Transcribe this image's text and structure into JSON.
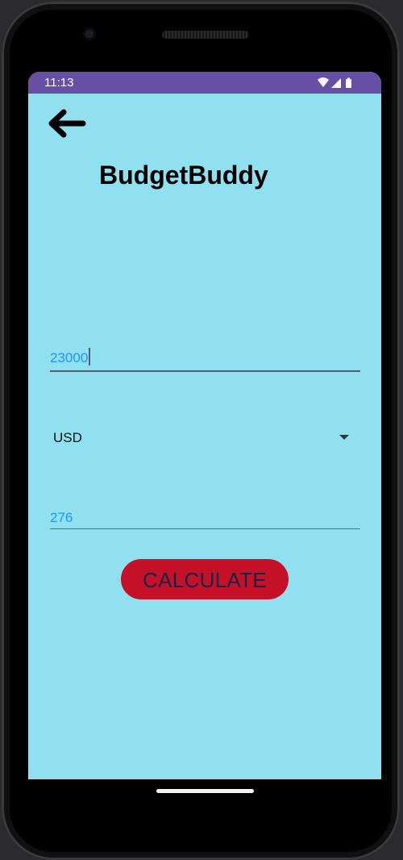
{
  "status_bar": {
    "time": "11:13",
    "icons": [
      "wifi-icon",
      "cellular-signal-icon",
      "battery-icon"
    ]
  },
  "header": {
    "back_icon": "arrow-left-icon",
    "title": "BudgetBuddy"
  },
  "form": {
    "amount_value": "23000",
    "currency_selected": "USD",
    "result_value": "276",
    "calculate_label": "CALCULATE"
  },
  "colors": {
    "status_bar": "#6750a4",
    "background": "#91e0ef",
    "input_text": "#2196f3",
    "button": "#c51128",
    "button_text": "#152447"
  }
}
